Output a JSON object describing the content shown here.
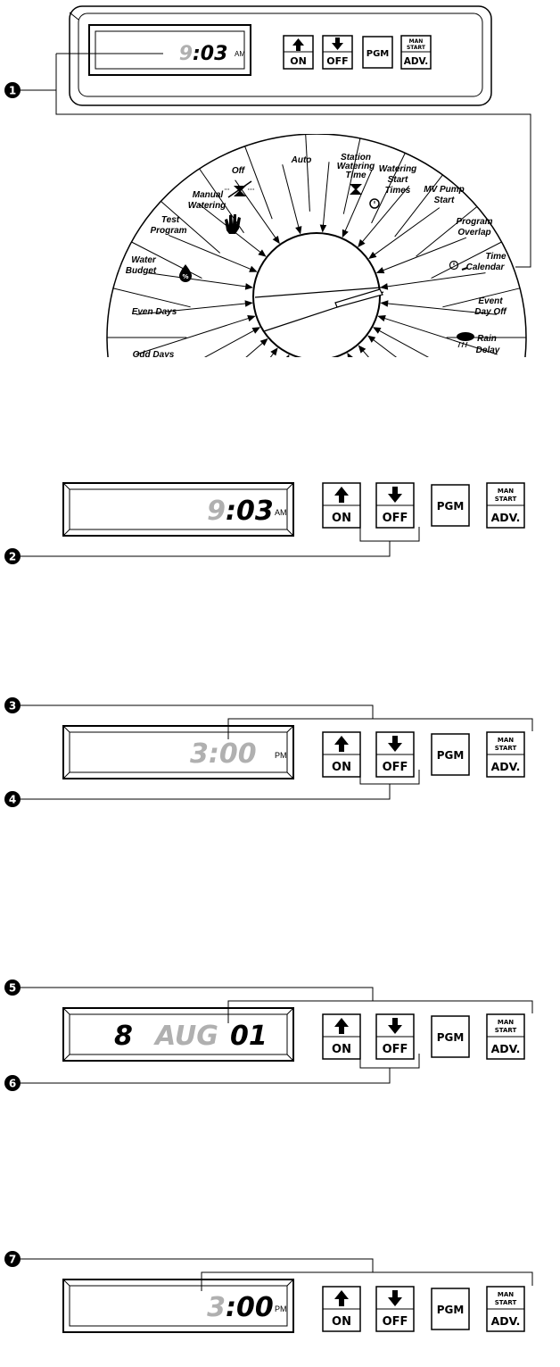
{
  "controller_top": {
    "display": {
      "hour": "9",
      "minutes": ":03",
      "ampm": "AM"
    },
    "buttons": {
      "on": "ON",
      "off": "OFF",
      "pgm": "PGM",
      "man": "MAN",
      "start": "START",
      "adv": "ADV."
    }
  },
  "dial": {
    "labels": {
      "auto": "Auto",
      "station_1": "Station",
      "station_2": "Watering",
      "station_3": "Time",
      "start_1": "Watering",
      "start_2": "Start",
      "start_3": "Times",
      "mv_1": "MV Pump",
      "mv_2": "Start",
      "overlap_1": "Program",
      "overlap_2": "Overlap",
      "timecal_1": "Time",
      "timecal_2": "Calendar",
      "event_1": "Event",
      "event_2": "Day Off",
      "rain_1": "Rain",
      "rain_2": "Delay",
      "off": "Off",
      "manual_1": "Manual",
      "manual_2": "Watering",
      "test_1": "Test",
      "test_2": "Program",
      "budget_1": "Water",
      "budget_2": "Budget",
      "even": "Even  Days",
      "odd": "Odd  Days",
      "cyclical": "Cyclical"
    }
  },
  "steps": [
    "1",
    "2",
    "3",
    "4",
    "5",
    "6",
    "7"
  ],
  "panel_2": {
    "hour": "9",
    "minutes": ":03",
    "ampm": "AM"
  },
  "panel_3": {
    "time": "3:00",
    "ampm": "PM"
  },
  "panel_4": {
    "day": "8",
    "month": "AUG",
    "year": "01"
  },
  "panel_5": {
    "hour": "3",
    "minutes": ":00",
    "ampm": "PM"
  },
  "buttons": {
    "on": "ON",
    "off": "OFF",
    "pgm": "PGM",
    "man": "MAN",
    "start": "START",
    "adv": "ADV."
  },
  "colors": {
    "ink": "#000000",
    "dim_segment": "#b0b0b0",
    "bezel": "#555555"
  }
}
